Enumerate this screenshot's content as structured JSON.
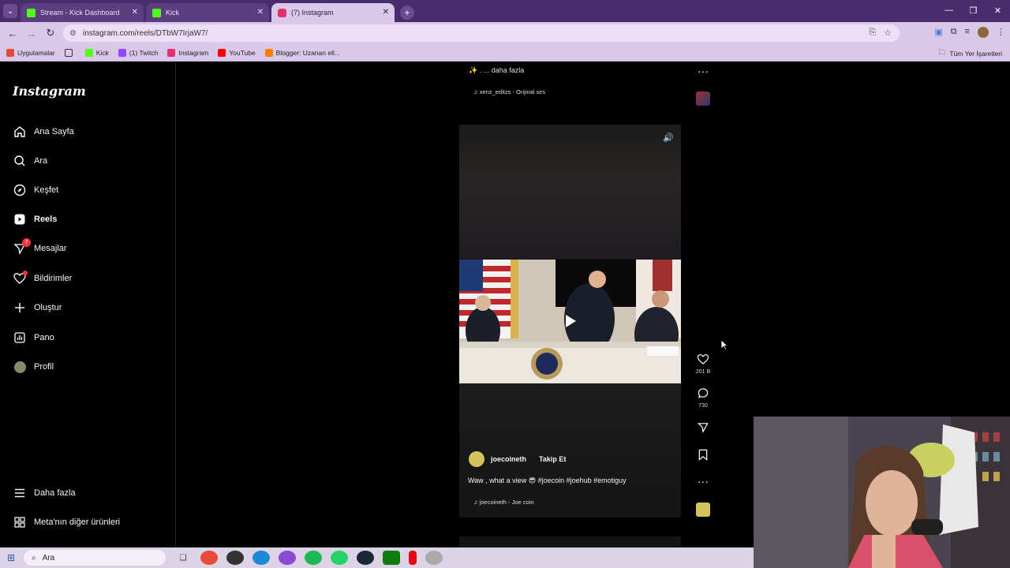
{
  "browser": {
    "tabs": [
      {
        "title": "Stream - Kick Dashboard",
        "favicon_color": "#53fc18",
        "active": false
      },
      {
        "title": "Kick",
        "favicon_color": "#53fc18",
        "active": false
      },
      {
        "title": "(7) Instagram",
        "favicon_color": "#e1306c",
        "active": true
      }
    ],
    "url": "instagram.com/reels/DTbW7IrjaW7/",
    "bookmarks": [
      {
        "label": "Uygulamalar",
        "icon": "apps-grid-icon"
      },
      {
        "label": "",
        "icon": "grid-icon"
      },
      {
        "label": "Kick",
        "icon": "kick-icon"
      },
      {
        "label": "(1) Twitch",
        "icon": "twitch-icon"
      },
      {
        "label": "Instagram",
        "icon": "instagram-icon"
      },
      {
        "label": "YouTube",
        "icon": "youtube-icon"
      },
      {
        "label": "Blogger: Uzanan ell...",
        "icon": "blogger-icon"
      }
    ],
    "bookmarks_right": "Tüm Yer İşaretleri"
  },
  "sidebar": {
    "logo": "Instagram",
    "items": [
      {
        "label": "Ana Sayfa",
        "icon": "home-icon"
      },
      {
        "label": "Ara",
        "icon": "search-icon"
      },
      {
        "label": "Keşfet",
        "icon": "compass-icon"
      },
      {
        "label": "Reels",
        "icon": "reels-icon",
        "active": true
      },
      {
        "label": "Mesajlar",
        "icon": "messenger-icon",
        "badge": "7"
      },
      {
        "label": "Bildirimler",
        "icon": "heart-icon"
      },
      {
        "label": "Oluştur",
        "icon": "plus-icon"
      },
      {
        "label": "Pano",
        "icon": "dashboard-icon"
      },
      {
        "label": "Profil",
        "icon": "avatar-icon"
      }
    ],
    "bottom": [
      {
        "label": "Daha fazla",
        "icon": "menu-icon"
      },
      {
        "label": "Meta'nın diğer ürünleri",
        "icon": "meta-icon"
      }
    ]
  },
  "prev_reel": {
    "caption": "✨ . ... daha fazla",
    "audio": "xenz_editzs - Orijinal ses"
  },
  "reel": {
    "author": "joecoineth",
    "follow_label": "Takip Et",
    "caption": "Waw , what a view 😎 #joecoin #joehub #emotiguy",
    "audio": "joecoineth - Joe coin",
    "likes": "201 B",
    "comments": "730"
  },
  "taskbar": {
    "search_placeholder": "Ara"
  },
  "colors": {
    "browser_frame": "#4a2b6e",
    "toolbar": "#d9c8ea",
    "instagram_bg": "#000000",
    "notification_red": "#ff3040"
  }
}
